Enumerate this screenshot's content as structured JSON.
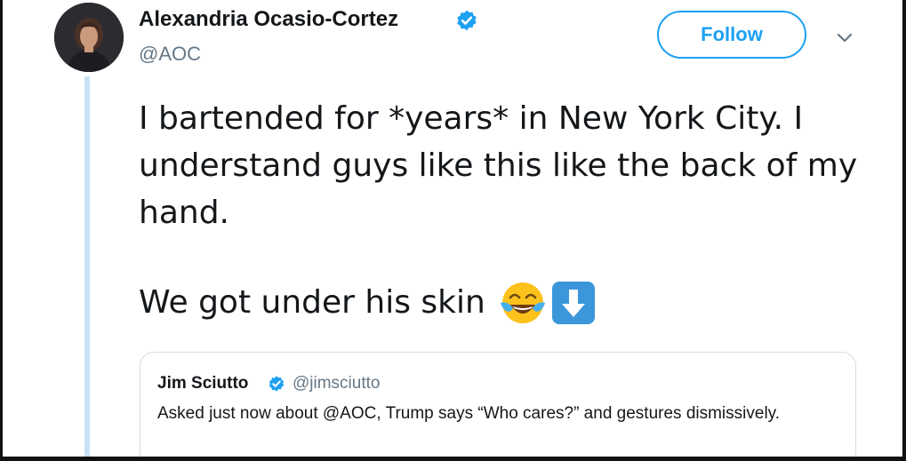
{
  "tweet": {
    "author": {
      "name": "Alexandria Ocasio-Cortez",
      "handle": "@AOC",
      "verified": true
    },
    "follow_label": "Follow",
    "text": "I bartended for *years* in New York City. I understand guys like this like the back of my hand.",
    "text_2": "We got under his skin",
    "emojis": [
      "face-with-tears-of-joy",
      "down-arrow-button"
    ]
  },
  "quoted_tweet": {
    "author": {
      "name": "Jim Sciutto",
      "handle": "@jimsciutto",
      "verified": true
    },
    "text": "Asked just now about @AOC, Trump says “Who cares?” and gestures dismissively."
  },
  "colors": {
    "accent": "#1da1f2",
    "text": "#14171a",
    "secondary_text": "#657786",
    "thread_line": "#c6e3f5",
    "quote_border": "#d6dde3",
    "frame": "#111111"
  }
}
